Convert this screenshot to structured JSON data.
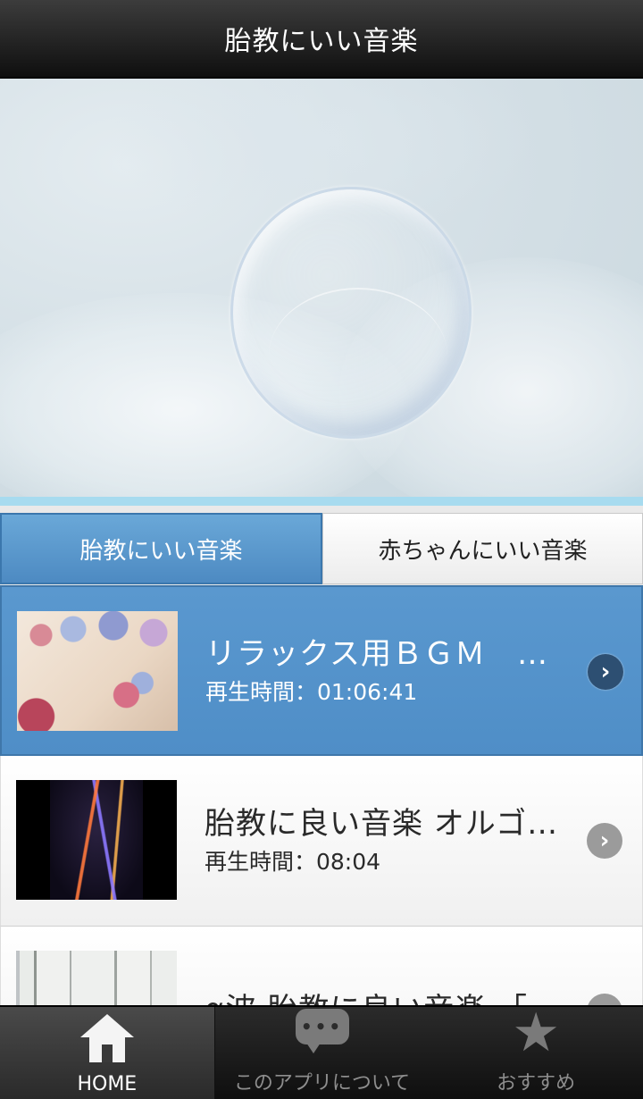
{
  "header": {
    "title": "胎教にいい音楽"
  },
  "tabs": [
    {
      "label": "胎教にいい音楽",
      "active": true
    },
    {
      "label": "赤ちゃんにいい音楽",
      "active": false
    }
  ],
  "list": [
    {
      "title": "リラックス用ＢＧＭ　…",
      "duration": "再生時間：01:06:41",
      "selected": true
    },
    {
      "title": "胎教に良い音楽 オルゴ…",
      "duration": "再生時間：08:04",
      "selected": false
    },
    {
      "title": "α波 胎教に良い音楽 「…",
      "duration": "",
      "selected": false
    }
  ],
  "bottom_nav": [
    {
      "label": "HOME",
      "icon": "home-icon",
      "active": true
    },
    {
      "label": "このアプリについて",
      "icon": "chat-icon",
      "active": false
    },
    {
      "label": "おすすめ",
      "icon": "star-icon",
      "active": false
    }
  ],
  "colors": {
    "accent": "#5a98cf",
    "header_bg": "#1e1e1e",
    "tab_active": "#5b99cf"
  }
}
